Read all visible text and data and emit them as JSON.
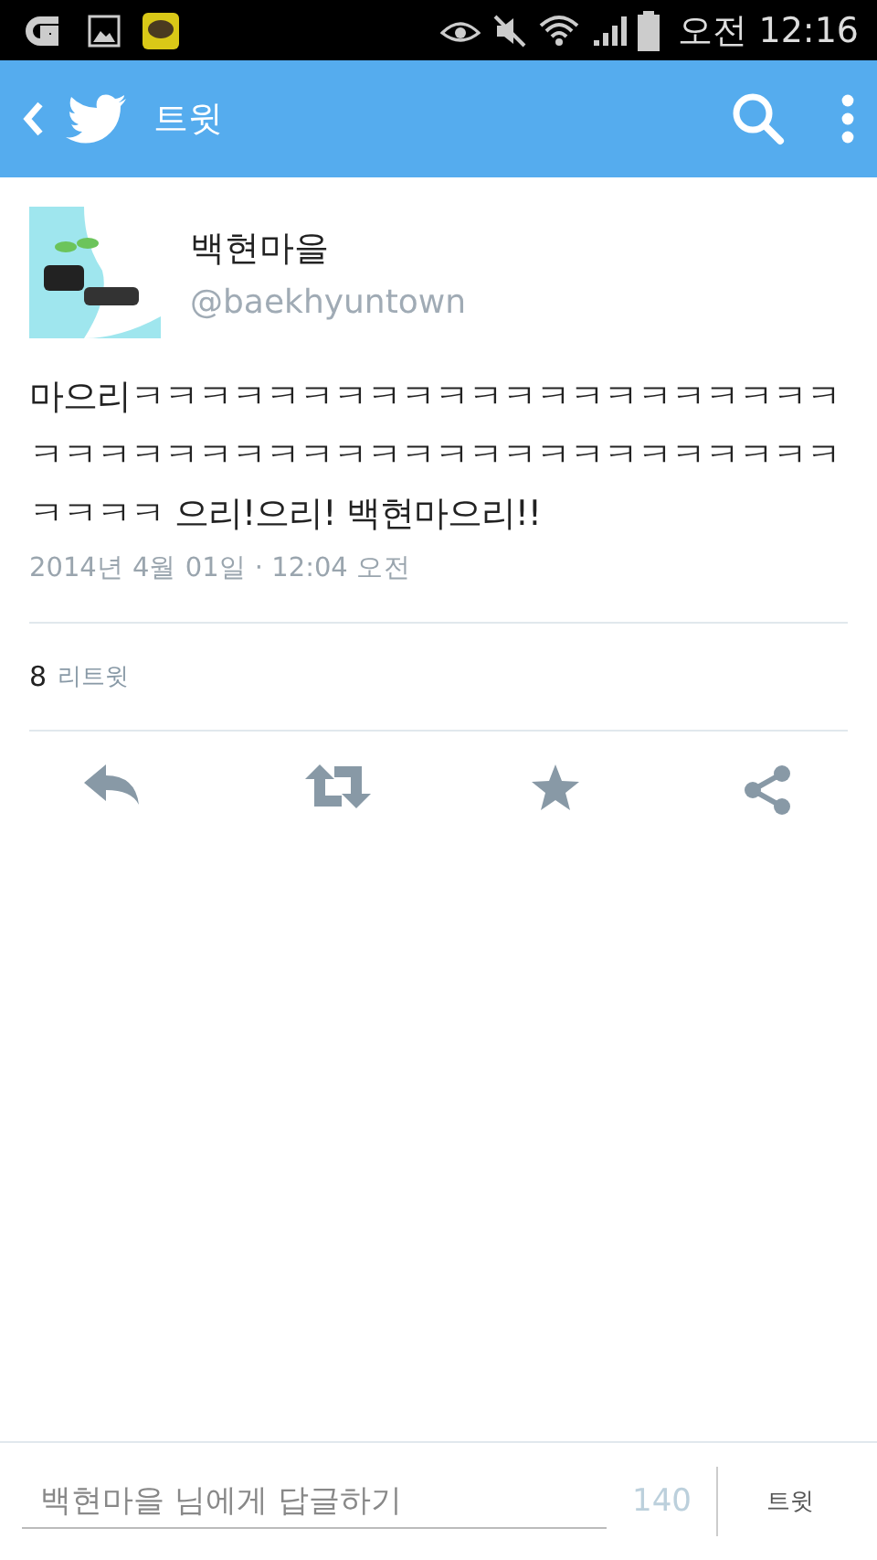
{
  "status_bar": {
    "time": "오전 12:16"
  },
  "app_bar": {
    "title": "트윗"
  },
  "tweet": {
    "display_name": "백현마을",
    "handle": "@baekhyuntown",
    "text": "마으리ㅋㅋㅋㅋㅋㅋㅋㅋㅋㅋㅋㅋㅋㅋㅋㅋㅋㅋㅋㅋㅋㅋㅋㅋㅋㅋㅋㅋㅋㅋㅋㅋㅋㅋㅋㅋㅋㅋㅋㅋㅋㅋㅋㅋㅋㅋㅋㅋㅋ 으리!으리! 백현마으리!!",
    "timestamp": "2014년 4월 01일 · 12:04 오전",
    "retweet_count": "8",
    "retweet_label": "리트윗"
  },
  "reply_bar": {
    "placeholder": "백현마을 님에게 답글하기",
    "counter": "140",
    "button": "트윗"
  }
}
